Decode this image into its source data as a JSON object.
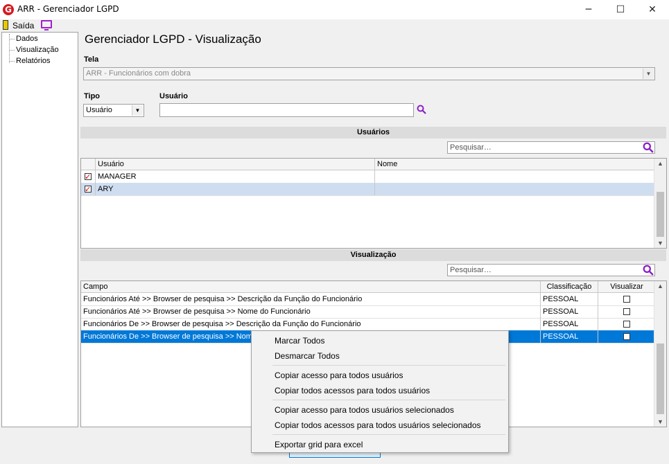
{
  "window": {
    "app_icon": "G",
    "title": "ARR - Gerenciador LGPD",
    "minimize": "─",
    "maximize": "☐",
    "close": "✕"
  },
  "toolbar": {
    "exit_label": "Saída"
  },
  "tree": {
    "items": [
      "Dados",
      "Visualização",
      "Relatórios"
    ]
  },
  "page_title": "Gerenciador LGPD - Visualização",
  "tela": {
    "label": "Tela",
    "value": "ARR - Funcionários com dobra"
  },
  "tipo": {
    "label": "Tipo",
    "value": "Usuário"
  },
  "usuario": {
    "label": "Usuário",
    "value": ""
  },
  "usuarios_section": {
    "title": "Usuários",
    "search_placeholder": "Pesquisar…",
    "columns": [
      "Usuário",
      "Nome"
    ],
    "rows": [
      {
        "usuario": "MANAGER",
        "nome": "",
        "checked": true
      },
      {
        "usuario": "ARY",
        "nome": "",
        "checked": true
      }
    ]
  },
  "visualizacao_section": {
    "title": "Visualização",
    "search_placeholder": "Pesquisar…",
    "columns": [
      "Campo",
      "Classificação",
      "Visualizar"
    ],
    "rows": [
      {
        "campo": "Funcionários Até >> Browser de pesquisa >> Descrição da Função do Funcionário",
        "classificacao": "PESSOAL",
        "visualizar": false
      },
      {
        "campo": "Funcionários Até >> Browser de pesquisa >> Nome do Funcionário",
        "classificacao": "PESSOAL",
        "visualizar": false
      },
      {
        "campo": "Funcionários De >> Browser de pesquisa >> Descrição da Função do Funcionário",
        "classificacao": "PESSOAL",
        "visualizar": false
      },
      {
        "campo": "Funcionários De >> Browser de pesquisa >> Nome",
        "classificacao": "PESSOAL",
        "visualizar": false
      }
    ]
  },
  "context_menu": {
    "items": [
      "Marcar Todos",
      "Desmarcar Todos",
      "Copiar acesso para todos usuários",
      "Copiar todos acessos para todos usuários",
      "Copiar acesso para todos usuários selecionados",
      "Copiar todos acessos para todos usuários selecionados",
      "Exportar grid para excel"
    ]
  },
  "colors": {
    "accent": "#0078d7",
    "selected_light": "#cfddf1",
    "search_icon": "#8b1fc9",
    "logo": "#d71920"
  }
}
